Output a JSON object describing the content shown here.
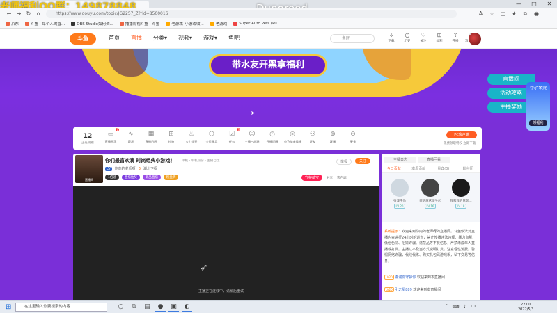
{
  "overlay": {
    "qq_text": "老师福利QQ群：149878848",
    "game_title": "Dungreed"
  },
  "browser": {
    "url": "https://www.douyu.com/topic/JG2257_Z?rid=8500016",
    "bookmarks": [
      "京东",
      "斗鱼 - 每个人的直...",
      "OBS Studio如何调...",
      "播播影视斗鱼 - 斗鱼",
      "老游戏_小游戏收...",
      "老游戏",
      "Super Auto Pets (Pu..."
    ],
    "window_controls": [
      "—",
      "□",
      "✕"
    ]
  },
  "site": {
    "logo": "斗鱼",
    "nav": [
      {
        "label": "首页"
      },
      {
        "label": "直播",
        "active": true
      },
      {
        "label": "分类▾"
      },
      {
        "label": "视频▾"
      },
      {
        "label": "游戏▾"
      },
      {
        "label": "鱼吧"
      }
    ],
    "search_placeholder": "一条团",
    "header_icons": [
      {
        "icon": "download-icon",
        "label": "下载"
      },
      {
        "icon": "history-icon",
        "label": "历史"
      },
      {
        "icon": "star-icon",
        "label": "关注"
      },
      {
        "icon": "gift-icon",
        "label": "福利"
      },
      {
        "icon": "upload-icon",
        "label": "开播"
      },
      {
        "icon": "message-icon",
        "label": "消息中心"
      }
    ]
  },
  "banner": {
    "headline": "带水友开黑拿福利"
  },
  "side_links": [
    "直播间",
    "活动攻略",
    "主播奖励"
  ],
  "promo_badge": {
    "title": "守护圣冠",
    "label": "领福利"
  },
  "toolbar": {
    "views": "12",
    "views_label": "正在观看",
    "items": [
      {
        "glyph": "▭",
        "label": "直播开黑",
        "badge": "1"
      },
      {
        "glyph": "∿",
        "label": "赛况"
      },
      {
        "glyph": "▦",
        "label": "直播日历"
      },
      {
        "glyph": "⊞",
        "label": "礼物"
      },
      {
        "glyph": "♨",
        "label": "火力全开"
      },
      {
        "glyph": "⬡",
        "label": "全民采兵"
      },
      {
        "glyph": "☑",
        "label": "任务",
        "badge": "3"
      },
      {
        "glyph": "☺",
        "label": "主播一起玩"
      },
      {
        "glyph": "◷",
        "label": "开播提醒"
      },
      {
        "glyph": "◎",
        "label": "小飞船来看播"
      },
      {
        "glyph": "⚇",
        "label": "好友"
      },
      {
        "glyph": "⊕",
        "label": "客服"
      },
      {
        "glyph": "⊖",
        "label": "更多"
      }
    ],
    "pc_button": "PC客户端",
    "pc_sub": "免费领取特权 立即下载"
  },
  "room": {
    "title": "你们最喜欢滴 时尚经典小游戏！",
    "category": "单机 › 单机热游 › 主播自选",
    "tag": "LV",
    "owner": "你向的老师呀",
    "level": "3",
    "extra": "湖北卫视",
    "thumb_label": "直播间",
    "chips": [
      {
        "label": "1倍速",
        "color": "#333"
      },
      {
        "label": "直播抽奖",
        "color": "#7c3be0"
      },
      {
        "label": "新品直播",
        "color": "#9a4de6"
      },
      {
        "label": "粉丝牌",
        "color": "#f0a020"
      }
    ],
    "report_btn": "举报",
    "follow_btn": "关注",
    "guard_btn": "守护萌宝",
    "tools": [
      "分享",
      "客户端"
    ],
    "video_status": "主播正在连线中，请稍后重试"
  },
  "chat": {
    "top_tabs": [
      "主播日志",
      "直播回看"
    ],
    "tabs": [
      "今日贡献",
      "本周贡献",
      "贵宾(0)",
      "粉丝团"
    ],
    "ranks": [
      {
        "name": "张溪宁你",
        "level": "LV 20"
      },
      {
        "name": "黎明就这麽生起",
        "level": "LV 16"
      },
      {
        "name": "我和我的兄弟...",
        "level": "LV 18"
      }
    ],
    "system_label": "系统提示：",
    "system_text": "欢迎来到你向的老师呀的直播间。斗鱼依法对直播内容进行24小时的巡查，禁止传播违法违规、暴力血腥、低俗色情、招嫖诈骗、违禁品等不良信息，严禁未成年人直播或打赏。主播认不及当方式说明打赏，注意理性消费。警惕网络诈骗，代线代练、购买礼包码游戏币，私下交易等信息。",
    "messages": [
      {
        "lv": "LV20",
        "user": "谢谢你守护你",
        "text": "欢迎来到本直播间"
      },
      {
        "lv": "LV20",
        "user": "引之星889",
        "text": "欢迎来到本直播间"
      }
    ]
  },
  "taskbar": {
    "search_placeholder": "在这里输入你要搜索的内容",
    "time": "22:00",
    "date": "2022/5/3",
    "apps": [
      "○",
      "⧉",
      "▤",
      "●",
      "▣",
      "◐"
    ]
  },
  "colors": {
    "accent": "#ff5d23",
    "banner": "#7a2fd8",
    "side_link": "#19b4c8"
  }
}
